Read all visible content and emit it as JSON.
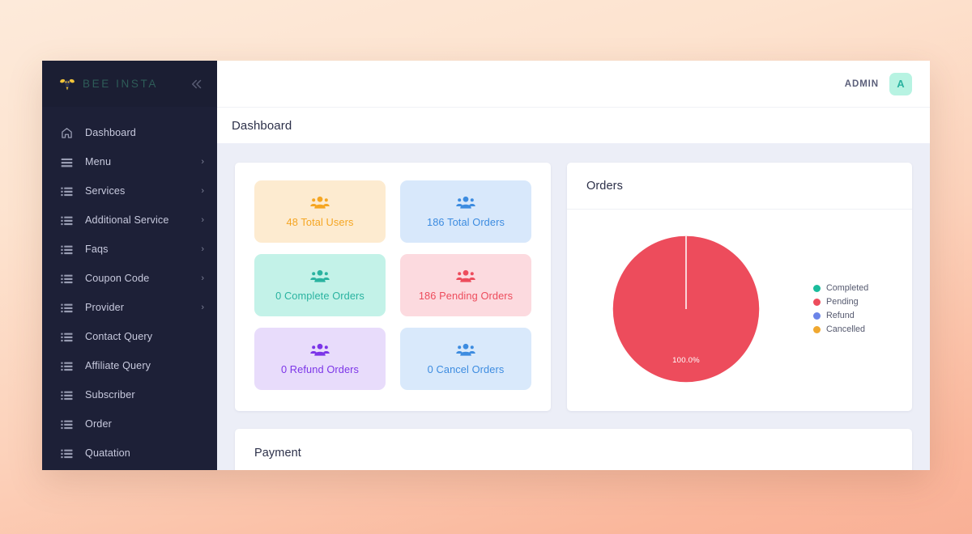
{
  "brand": {
    "name": "BEE INSTA",
    "logo_icon": "bee-icon",
    "collapse_icon": "double-chevron-left-icon"
  },
  "sidebar": {
    "items": [
      {
        "label": "Dashboard",
        "icon": "home-icon",
        "has_arrow": false,
        "active": true
      },
      {
        "label": "Menu",
        "icon": "hamburger-icon",
        "has_arrow": true,
        "active": false
      },
      {
        "label": "Services",
        "icon": "list-icon",
        "has_arrow": true,
        "active": false
      },
      {
        "label": "Additional Service",
        "icon": "list-icon",
        "has_arrow": true,
        "active": false
      },
      {
        "label": "Faqs",
        "icon": "list-icon",
        "has_arrow": true,
        "active": false
      },
      {
        "label": "Coupon Code",
        "icon": "list-icon",
        "has_arrow": true,
        "active": false
      },
      {
        "label": "Provider",
        "icon": "list-icon",
        "has_arrow": true,
        "active": false
      },
      {
        "label": "Contact Query",
        "icon": "list-icon",
        "has_arrow": false,
        "active": false
      },
      {
        "label": "Affiliate Query",
        "icon": "list-icon",
        "has_arrow": false,
        "active": false
      },
      {
        "label": "Subscriber",
        "icon": "list-icon",
        "has_arrow": false,
        "active": false
      },
      {
        "label": "Order",
        "icon": "list-icon",
        "has_arrow": false,
        "active": false
      },
      {
        "label": "Quatation",
        "icon": "list-icon",
        "has_arrow": false,
        "active": false
      }
    ],
    "arrow_glyph": "›"
  },
  "topbar": {
    "admin_label": "ADMIN",
    "avatar_initial": "A"
  },
  "page": {
    "title": "Dashboard"
  },
  "stats": {
    "cards": [
      {
        "label": "48 Total Users",
        "value": 48,
        "name": "Total Users",
        "bg": "#fdebd0",
        "fg": "#f5a623",
        "icon": "users-group-icon"
      },
      {
        "label": "186 Total Orders",
        "value": 186,
        "name": "Total Orders",
        "bg": "#d8e8fb",
        "fg": "#3d8ce0",
        "icon": "users-group-icon"
      },
      {
        "label": "0 Complete Orders",
        "value": 0,
        "name": "Complete Orders",
        "bg": "#c3f2e8",
        "fg": "#2ab3a0",
        "icon": "users-group-icon"
      },
      {
        "label": "186 Pending Orders",
        "value": 186,
        "name": "Pending Orders",
        "bg": "#fcdadf",
        "fg": "#ed4c5c",
        "icon": "users-group-icon"
      },
      {
        "label": "0 Refund Orders",
        "value": 0,
        "name": "Refund Orders",
        "bg": "#e8dcfb",
        "fg": "#7c35e8",
        "icon": "users-group-icon"
      },
      {
        "label": "0 Cancel Orders",
        "value": 0,
        "name": "Cancel Orders",
        "bg": "#d9e9fb",
        "fg": "#3d8ce0",
        "icon": "users-group-icon"
      }
    ]
  },
  "orders_panel": {
    "title": "Orders"
  },
  "payment_panel": {
    "title": "Payment"
  },
  "chart_data": {
    "type": "pie",
    "title": "Orders",
    "categories": [
      "Completed",
      "Pending",
      "Refund",
      "Cancelled"
    ],
    "values": [
      0,
      100,
      0,
      0
    ],
    "value_unit": "%",
    "labels": [
      "",
      "100.0%",
      "",
      ""
    ],
    "colors": [
      "#1abc9c",
      "#ed4c5c",
      "#6b84e8",
      "#f0a830"
    ],
    "legend_position": "right",
    "slice_border_color": "#ffffff",
    "start_angle_deg": 0,
    "data_label_shown": "100.0%"
  }
}
